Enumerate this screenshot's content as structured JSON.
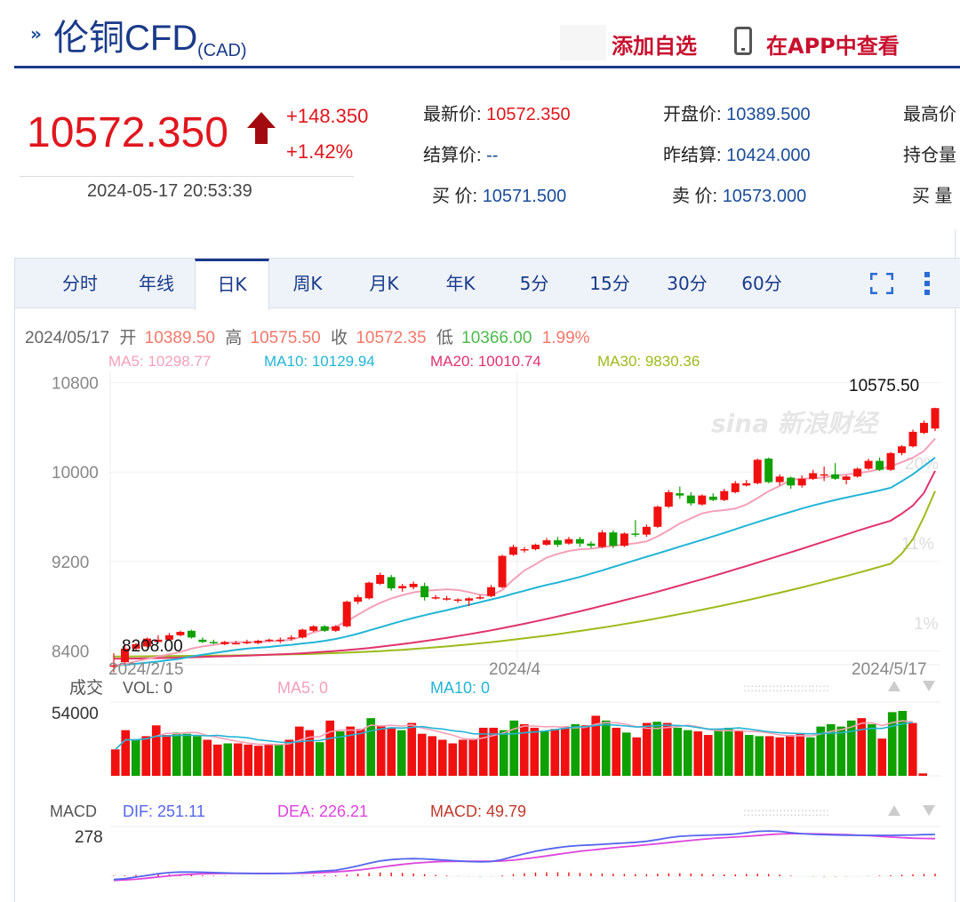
{
  "header": {
    "title": "伦铜CFD",
    "currency": "(CAD)",
    "add_watchlist": "添加自选",
    "view_in_app": "在APP中查看"
  },
  "quote": {
    "price": "10572.350",
    "change": "+148.350",
    "change_pct": "+1.42%",
    "time": "2024-05-17 20:53:39",
    "fields": {
      "latest_label": "最新价:",
      "latest": "10572.350",
      "open_label": "开盘价:",
      "open": "10389.500",
      "high_label": "最高价",
      "settle_label": "结算价:",
      "settle": "--",
      "prev_settle_label": "昨结算:",
      "prev_settle": "10424.000",
      "oi_label": "持仓量",
      "bid_label": "买  价:",
      "bid": "10571.500",
      "ask_label": "卖  价:",
      "ask": "10573.000",
      "bidvol_label": "买  量"
    }
  },
  "tabs": [
    "分时",
    "年线",
    "日K",
    "周K",
    "月K",
    "年K",
    "5分",
    "15分",
    "30分",
    "60分"
  ],
  "active_tab": "日K",
  "ohlc": {
    "date": "2024/05/17",
    "open_label": "开",
    "open": "10389.50",
    "high_label": "高",
    "high": "10575.50",
    "close_label": "收",
    "close": "10572.35",
    "low_label": "低",
    "low": "10366.00",
    "pct": "1.99%"
  },
  "ma_legend": {
    "ma5": "MA5: 10298.77",
    "ma10": "MA10: 10129.94",
    "ma20": "MA20: 10010.74",
    "ma30": "MA30: 9830.36"
  },
  "watermark": "sina 新浪财经",
  "pct_labels": [
    "20%",
    "11%",
    "1%"
  ],
  "max_label": "10575.50",
  "min_label": "8208.00",
  "volume": {
    "title": "成交",
    "vol": "VOL: 0",
    "ma5": "MA5: 0",
    "ma10": "MA10: 0",
    "ymax": "54000"
  },
  "macd": {
    "title": "MACD",
    "dif": "DIF: 251.11",
    "dea": "DEA: 226.21",
    "macd": "MACD: 49.79",
    "ymax": "278"
  },
  "colors": {
    "up": "#f01010",
    "down": "#0ea100",
    "ma5": "#f4a0b8",
    "ma10": "#22b5d6",
    "ma20": "#e0336b",
    "ma30": "#9cbb1a",
    "dif": "#5566ee",
    "dea": "#dd44dd"
  },
  "chart_data": {
    "type": "candlestick",
    "x_ticks": [
      "2024/2/15",
      "2024/4",
      "2024/5/17"
    ],
    "ylim": [
      8300,
      10900
    ],
    "y_ticks": [
      8400,
      9200,
      10000,
      10800
    ],
    "candles": [
      [
        8270,
        8380,
        8208,
        8270
      ],
      [
        8300,
        8450,
        8280,
        8420
      ],
      [
        8420,
        8470,
        8400,
        8460
      ],
      [
        8440,
        8520,
        8430,
        8510
      ],
      [
        8480,
        8540,
        8470,
        8500
      ],
      [
        8500,
        8560,
        8490,
        8540
      ],
      [
        8540,
        8580,
        8530,
        8570
      ],
      [
        8580,
        8590,
        8510,
        8520
      ],
      [
        8500,
        8520,
        8470,
        8480
      ],
      [
        8480,
        8500,
        8460,
        8470
      ],
      [
        8460,
        8490,
        8450,
        8480
      ],
      [
        8470,
        8490,
        8460,
        8470
      ],
      [
        8470,
        8500,
        8460,
        8480
      ],
      [
        8470,
        8500,
        8460,
        8490
      ],
      [
        8490,
        8510,
        8480,
        8500
      ],
      [
        8490,
        8520,
        8470,
        8500
      ],
      [
        8510,
        8540,
        8490,
        8520
      ],
      [
        8520,
        8600,
        8510,
        8590
      ],
      [
        8580,
        8630,
        8570,
        8620
      ],
      [
        8620,
        8630,
        8570,
        8580
      ],
      [
        8580,
        8630,
        8570,
        8620
      ],
      [
        8620,
        8850,
        8610,
        8840
      ],
      [
        8840,
        8900,
        8820,
        8880
      ],
      [
        8870,
        9020,
        8860,
        9010
      ],
      [
        9000,
        9100,
        8990,
        9080
      ],
      [
        9060,
        9080,
        8940,
        8960
      ],
      [
        8960,
        9000,
        8930,
        8980
      ],
      [
        8970,
        9020,
        8950,
        9000
      ],
      [
        8980,
        9010,
        8850,
        8880
      ],
      [
        8880,
        8900,
        8860,
        8880
      ],
      [
        8870,
        8890,
        8850,
        8870
      ],
      [
        8860,
        8870,
        8830,
        8860
      ],
      [
        8850,
        8880,
        8800,
        8870
      ],
      [
        8880,
        8900,
        8860,
        8880
      ],
      [
        8890,
        8990,
        8880,
        8970
      ],
      [
        8970,
        9260,
        8960,
        9250
      ],
      [
        9260,
        9350,
        9250,
        9330
      ],
      [
        9300,
        9330,
        9280,
        9310
      ],
      [
        9310,
        9360,
        9300,
        9350
      ],
      [
        9350,
        9410,
        9340,
        9390
      ],
      [
        9390,
        9420,
        9330,
        9350
      ],
      [
        9360,
        9420,
        9350,
        9400
      ],
      [
        9400,
        9420,
        9330,
        9360
      ],
      [
        9360,
        9380,
        9320,
        9340
      ],
      [
        9330,
        9480,
        9320,
        9460
      ],
      [
        9460,
        9480,
        9320,
        9340
      ],
      [
        9340,
        9460,
        9330,
        9450
      ],
      [
        9450,
        9570,
        9420,
        9440
      ],
      [
        9440,
        9530,
        9420,
        9510
      ],
      [
        9510,
        9700,
        9500,
        9690
      ],
      [
        9690,
        9840,
        9680,
        9820
      ],
      [
        9810,
        9870,
        9760,
        9790
      ],
      [
        9790,
        9820,
        9700,
        9720
      ],
      [
        9710,
        9800,
        9700,
        9790
      ],
      [
        9780,
        9810,
        9740,
        9750
      ],
      [
        9750,
        9850,
        9740,
        9830
      ],
      [
        9820,
        9920,
        9810,
        9900
      ],
      [
        9880,
        9930,
        9870,
        9900
      ],
      [
        9900,
        10120,
        9890,
        10110
      ],
      [
        10120,
        10130,
        9900,
        9910
      ],
      [
        9910,
        9980,
        9880,
        9960
      ],
      [
        9950,
        9960,
        9850,
        9880
      ],
      [
        9880,
        9970,
        9860,
        9940
      ],
      [
        9940,
        10020,
        9930,
        9990
      ],
      [
        9980,
        10050,
        9920,
        9980
      ],
      [
        9980,
        10080,
        9930,
        9940
      ],
      [
        9930,
        9970,
        9890,
        9960
      ],
      [
        9960,
        10040,
        9950,
        10030
      ],
      [
        10030,
        10120,
        10020,
        10100
      ],
      [
        10100,
        10130,
        10010,
        10020
      ],
      [
        10020,
        10180,
        10010,
        10170
      ],
      [
        10170,
        10240,
        10150,
        10230
      ],
      [
        10230,
        10380,
        10220,
        10360
      ],
      [
        10350,
        10460,
        10340,
        10440
      ],
      [
        10389.5,
        10575.5,
        10366,
        10572.35
      ]
    ],
    "ma5": [
      8270,
      8283,
      8306,
      8328,
      8350,
      8369,
      8390,
      8420,
      8440,
      8453,
      8469,
      8477,
      8478,
      8480,
      8486,
      8491,
      8500,
      8528,
      8566,
      8592,
      8617,
      8665,
      8723,
      8781,
      8830,
      8869,
      8899,
      8923,
      8938,
      8944,
      8951,
      8945,
      8926,
      8902,
      8897,
      8944,
      9037,
      9120,
      9175,
      9235,
      9268,
      9294,
      9309,
      9314,
      9327,
      9340,
      9353,
      9362,
      9380,
      9424,
      9480,
      9540,
      9586,
      9630,
      9650,
      9660,
      9673,
      9710,
      9767,
      9829,
      9876,
      9930,
      9940,
      9944,
      9952,
      9968,
      9978,
      9990,
      10005,
      10026,
      10052,
      10088,
      10128,
      10188,
      10298.77
    ],
    "ma10": [
      8270,
      8275,
      8285,
      8295,
      8305,
      8318,
      8330,
      8350,
      8365,
      8380,
      8395,
      8410,
      8420,
      8428,
      8435,
      8446,
      8454,
      8466,
      8476,
      8490,
      8507,
      8529,
      8554,
      8583,
      8611,
      8640,
      8668,
      8694,
      8719,
      8742,
      8764,
      8788,
      8812,
      8836,
      8860,
      8884,
      8912,
      8938,
      8965,
      8990,
      9012,
      9036,
      9062,
      9090,
      9120,
      9151,
      9181,
      9212,
      9242,
      9272,
      9302,
      9333,
      9363,
      9393,
      9424,
      9455,
      9488,
      9521,
      9553,
      9584,
      9614,
      9644,
      9674,
      9701,
      9726,
      9750,
      9772,
      9793,
      9814,
      9835,
      9860,
      9918,
      9980,
      10054,
      10129.94
    ],
    "ma20": [
      8330,
      8331,
      8332,
      8334,
      8336,
      8338,
      8340,
      8343,
      8346,
      8349,
      8352,
      8355,
      8358,
      8362,
      8366,
      8370,
      8374,
      8379,
      8385,
      8392,
      8399,
      8407,
      8416,
      8426,
      8437,
      8449,
      8461,
      8474,
      8488,
      8502,
      8517,
      8533,
      8549,
      8566,
      8584,
      8603,
      8623,
      8643,
      8664,
      8686,
      8708,
      8731,
      8754,
      8778,
      8803,
      8828,
      8853,
      8878,
      8903,
      8930,
      8957,
      8985,
      9013,
      9041,
      9070,
      9099,
      9129,
      9159,
      9190,
      9221,
      9252,
      9283,
      9314,
      9346,
      9378,
      9410,
      9442,
      9474,
      9505,
      9535,
      9565,
      9628,
      9700,
      9814,
      10010.74
    ],
    "ma30": [
      8350,
      8350,
      8351,
      8352,
      8353,
      8354,
      8355,
      8356,
      8357,
      8358,
      8359,
      8360,
      8361,
      8363,
      8365,
      8367,
      8369,
      8371,
      8374,
      8377,
      8380,
      8384,
      8388,
      8393,
      8398,
      8404,
      8410,
      8417,
      8424,
      8432,
      8440,
      8449,
      8458,
      8468,
      8478,
      8489,
      8500,
      8512,
      8524,
      8537,
      8550,
      8564,
      8578,
      8593,
      8608,
      8624,
      8640,
      8657,
      8674,
      8692,
      8710,
      8729,
      8748,
      8768,
      8788,
      8809,
      8830,
      8852,
      8874,
      8897,
      8920,
      8944,
      8968,
      8993,
      9018,
      9044,
      9070,
      9097,
      9124,
      9152,
      9180,
      9270,
      9400,
      9600,
      9830.36
    ],
    "volume": [
      22000,
      38000,
      30000,
      33000,
      42000,
      34000,
      36000,
      35000,
      33000,
      30000,
      26000,
      27000,
      27000,
      26000,
      25000,
      26000,
      26000,
      30000,
      41000,
      38000,
      28000,
      46000,
      37000,
      41000,
      39000,
      48000,
      42000,
      40000,
      38000,
      44000,
      35000,
      33000,
      30000,
      27000,
      30000,
      31000,
      40000,
      40000,
      38000,
      46000,
      43000,
      40000,
      37000,
      39000,
      41000,
      43000,
      42000,
      50000,
      46000,
      40000,
      36000,
      32000,
      44000,
      45000,
      44000,
      40000,
      38000,
      37000,
      34000,
      39000,
      40000,
      38000,
      34000,
      33000,
      33000,
      32000,
      34000,
      35000,
      32000,
      41000,
      43000,
      41000,
      46000,
      48000,
      43000,
      31000,
      53000,
      54000,
      44000,
      2000
    ],
    "vol_up": [
      true,
      true,
      false,
      true,
      true,
      true,
      false,
      false,
      false,
      true,
      true,
      false,
      true,
      true,
      true,
      true,
      false,
      true,
      true,
      true,
      false,
      true,
      false,
      true,
      true,
      false,
      true,
      true,
      false,
      true,
      true,
      true,
      true,
      true,
      true,
      true,
      true,
      true,
      false,
      false,
      true,
      true,
      false,
      true,
      true,
      false,
      true,
      true,
      false,
      true,
      false,
      true,
      true,
      false,
      true,
      false,
      false,
      true,
      true,
      false,
      false,
      true,
      false,
      false,
      true,
      true,
      true,
      true,
      false,
      false,
      false,
      false,
      false,
      true,
      false,
      true,
      false,
      false,
      true,
      true
    ],
    "macd": {
      "dif": [
        -20,
        -15,
        -5,
        5,
        15,
        22,
        25,
        25,
        24,
        22,
        20,
        18,
        17,
        16,
        16,
        17,
        18,
        22,
        28,
        32,
        36,
        48,
        62,
        78,
        92,
        100,
        104,
        106,
        104,
        100,
        96,
        92,
        88,
        86,
        88,
        100,
        118,
        135,
        150,
        162,
        172,
        180,
        185,
        188,
        192,
        196,
        200,
        204,
        210,
        220,
        232,
        240,
        244,
        246,
        248,
        250,
        254,
        262,
        270,
        272,
        270,
        262,
        256,
        252,
        250,
        248,
        247,
        246,
        246,
        246,
        246,
        247,
        248,
        250,
        251.11
      ],
      "dea": [
        -25,
        -22,
        -18,
        -12,
        -5,
        2,
        8,
        12,
        15,
        16,
        17,
        17,
        17,
        17,
        17,
        17,
        17,
        18,
        20,
        23,
        26,
        31,
        37,
        45,
        54,
        63,
        71,
        78,
        83,
        87,
        89,
        90,
        90,
        90,
        90,
        92,
        97,
        104,
        113,
        122,
        132,
        141,
        150,
        157,
        164,
        171,
        177,
        183,
        189,
        195,
        202,
        209,
        216,
        222,
        228,
        232,
        236,
        240,
        245,
        250,
        254,
        256,
        256,
        255,
        254,
        252,
        250,
        247,
        244,
        240,
        236,
        232,
        229,
        227,
        226.21
      ],
      "hist": [
        5,
        7,
        13,
        17,
        20,
        20,
        17,
        13,
        9,
        6,
        3,
        1,
        0,
        -1,
        -1,
        0,
        1,
        4,
        8,
        9,
        10,
        17,
        25,
        33,
        38,
        37,
        33,
        28,
        21,
        13,
        7,
        2,
        -2,
        -4,
        -2,
        8,
        21,
        31,
        37,
        40,
        40,
        39,
        35,
        31,
        28,
        25,
        23,
        21,
        21,
        25,
        30,
        31,
        28,
        24,
        20,
        18,
        18,
        22,
        25,
        22,
        16,
        6,
        0,
        -3,
        -4,
        -4,
        -3,
        -1,
        2,
        6,
        10,
        15,
        19,
        23,
        24.9
      ]
    }
  }
}
